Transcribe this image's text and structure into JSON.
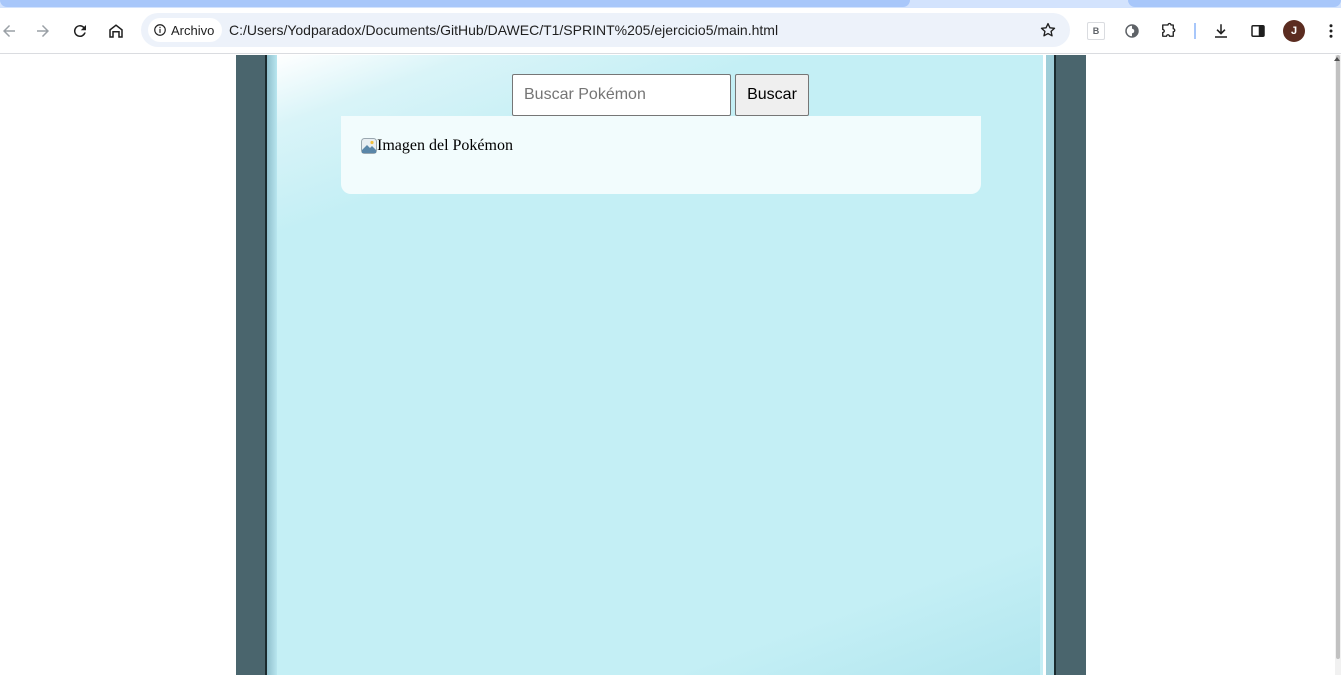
{
  "browser": {
    "chip_label": "Archivo",
    "url": "C:/Users/Yodparadox/Documents/GitHub/DAWEC/T1/SPRINT%205/ejercicio5/main.html",
    "extension_label": "B",
    "profile_initial": "J"
  },
  "page": {
    "search": {
      "placeholder": "Buscar Pokémon",
      "value": "",
      "button_label": "Buscar"
    },
    "result": {
      "image_alt": "Imagen del Pokémon"
    }
  },
  "colors": {
    "frame": "#4a656d",
    "screen": "#c4eff5",
    "card": "#f2fcfd"
  },
  "icons": [
    "back-icon",
    "forward-icon",
    "reload-icon",
    "home-icon",
    "info-icon",
    "star-icon",
    "extension-b-icon",
    "performance-icon",
    "puzzle-icon",
    "download-icon",
    "side-panel-icon",
    "avatar",
    "more-icon",
    "broken-image-icon"
  ]
}
